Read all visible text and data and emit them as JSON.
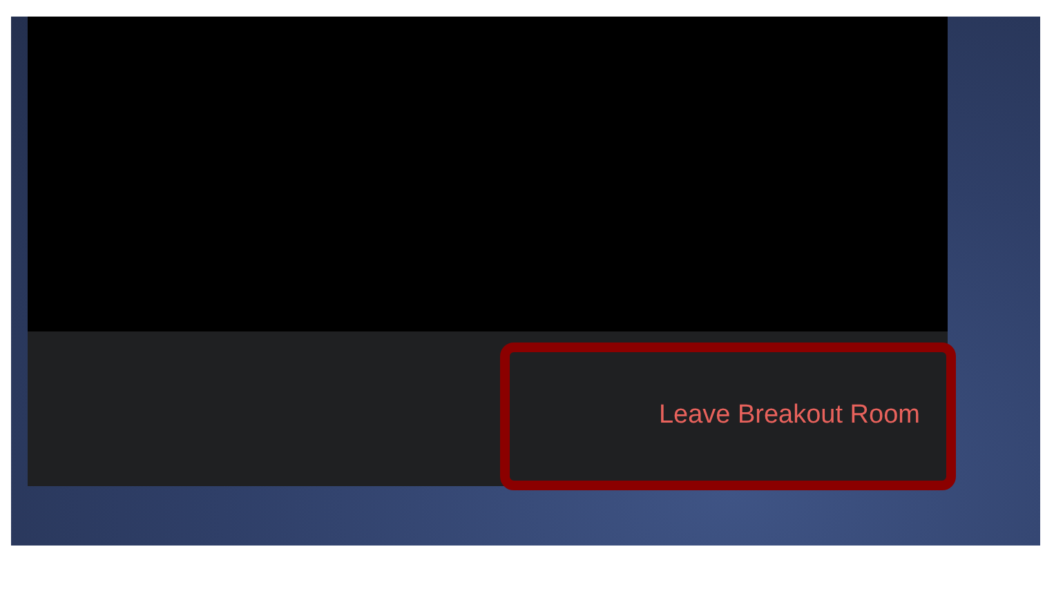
{
  "meeting_window": {
    "leave_button": {
      "label": "Leave Breakout Room",
      "highlighted": true
    }
  }
}
